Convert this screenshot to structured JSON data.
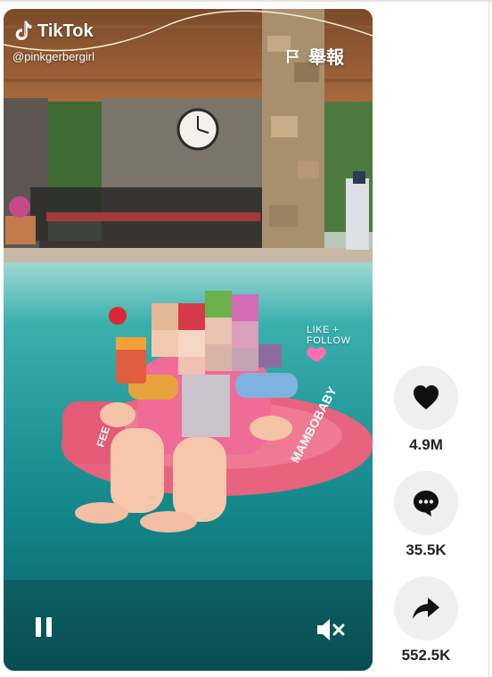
{
  "brand": {
    "name": "TikTok",
    "logo_icon": "tiktok-logo-icon"
  },
  "author": {
    "handle": "@pinkgerbergirl"
  },
  "report": {
    "label": "舉報",
    "icon": "flag-icon"
  },
  "video": {
    "sticker_text": "LIKE + FOLLOW",
    "float_brand": "MAMBOBABY",
    "float_side_text": "FEE",
    "controls": {
      "pause_icon": "pause-icon",
      "mute_icon": "muted-speaker-icon"
    }
  },
  "actions": {
    "like": {
      "icon": "heart-icon",
      "count": "4.9M"
    },
    "comment": {
      "icon": "comment-icon",
      "count": "35.5K"
    },
    "share": {
      "icon": "share-arrow-icon",
      "count": "552.5K"
    }
  },
  "colors": {
    "pool_water": "#1d8f90",
    "float_pink": "#e8637d",
    "action_bg": "#efefef"
  }
}
